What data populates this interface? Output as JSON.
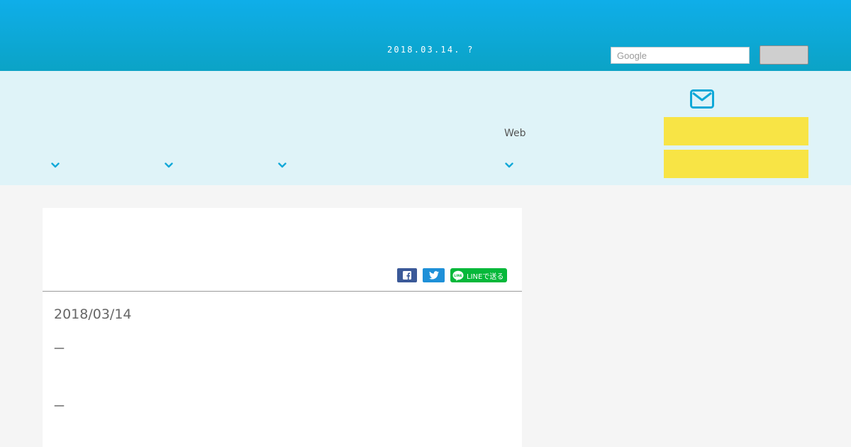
{
  "header": {
    "date_text": "2018.03.14. ?",
    "search": {
      "placeholder": "Google",
      "value": ""
    },
    "search_button_label": ""
  },
  "nav": {
    "items": [
      {
        "label": "",
        "icon": "chevron-down-icon"
      },
      {
        "label": "",
        "icon": "chevron-down-icon"
      },
      {
        "label": "",
        "icon": "chevron-down-icon"
      },
      {
        "label": "Web",
        "icon": "chevron-down-icon"
      }
    ],
    "contact_icon": "mail-icon",
    "cta_buttons": [
      {
        "label": ""
      },
      {
        "label": ""
      }
    ]
  },
  "article": {
    "share": {
      "facebook_icon": "facebook-icon",
      "twitter_icon": "twitter-icon",
      "line_label": "LINEで送る"
    },
    "date": "2018/03/14",
    "paragraphs": [
      "—",
      "—"
    ]
  },
  "colors": {
    "header_top": "#0faee9",
    "header_bottom": "#0ba3c6",
    "nav_bg": "#dff3f8",
    "accent": "#0fa8d8",
    "cta_yellow": "#f8e445",
    "facebook": "#3b5998",
    "twitter": "#1e90d8",
    "line": "#06b83a",
    "page_bg": "#f5f5f5"
  }
}
